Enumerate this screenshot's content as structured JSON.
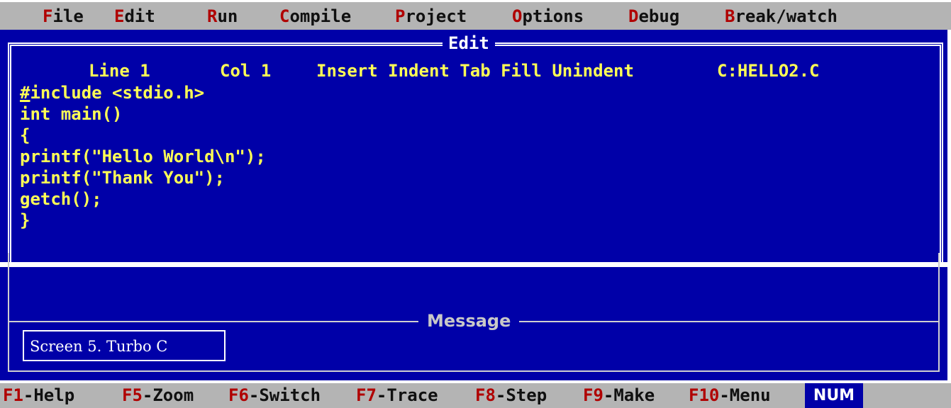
{
  "menu": [
    {
      "hot": "F",
      "rest": "ile"
    },
    {
      "hot": "E",
      "rest": "dit"
    },
    {
      "hot": "R",
      "rest": "un"
    },
    {
      "hot": "C",
      "rest": "ompile"
    },
    {
      "hot": "P",
      "rest": "roject"
    },
    {
      "hot": "O",
      "rest": "ptions"
    },
    {
      "hot": "D",
      "rest": "ebug"
    },
    {
      "hot": "B",
      "rest": "reak/watch"
    }
  ],
  "editor": {
    "title": "Edit",
    "status": {
      "line": "Line 1",
      "col": "Col 1",
      "modes": "Insert Indent Tab Fill Unindent",
      "file": "C:HELLO2.C"
    },
    "cursor_char": "#",
    "first_line_rest": "include <stdio.h>",
    "code_lines": [
      "int main()",
      "{",
      "printf(\"Hello World\\n\");",
      "printf(\"Thank You\");",
      "getch();",
      "}"
    ]
  },
  "message_panel": {
    "title": "Message",
    "caption": "Screen 5. Turbo C"
  },
  "fkeys": [
    {
      "key": "F1",
      "label": "-Help"
    },
    {
      "key": "F5",
      "label": "-Zoom"
    },
    {
      "key": "F6",
      "label": "-Switch"
    },
    {
      "key": "F7",
      "label": "-Trace"
    },
    {
      "key": "F8",
      "label": "-Step"
    },
    {
      "key": "F9",
      "label": "-Make"
    },
    {
      "key": "F10",
      "label": "-Menu"
    }
  ],
  "num_indicator": "NUM",
  "colors": {
    "background_blue": "#0000a8",
    "code_yellow": "#ffff55",
    "menu_gray": "#b4b4b4",
    "hotkey_red": "#b00000"
  }
}
